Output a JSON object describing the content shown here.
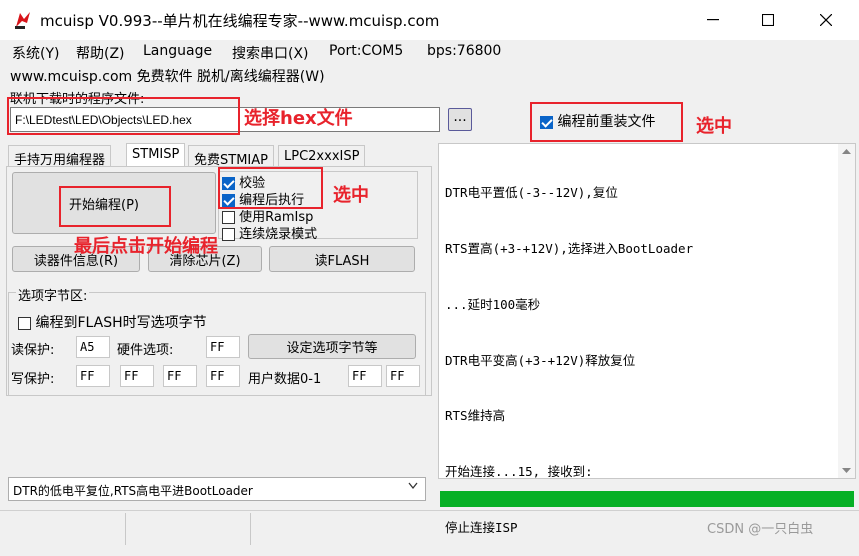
{
  "window": {
    "title": "mcuisp V0.993--单片机在线编程专家--www.mcuisp.com"
  },
  "menu": {
    "items": [
      "系统(Y)",
      "帮助(Z)",
      "Language",
      "搜索串口(X)",
      "Port:COM5",
      "bps:76800"
    ],
    "sub": "www.mcuisp.com 免费软件 脱机/离线编程器(W)"
  },
  "file": {
    "label": "联机下载时的程序文件:",
    "value": "F:\\LEDtest\\LED\\Objects\\LED.hex",
    "browse_label": "...",
    "reload_label": "编程前重装文件",
    "reload_checked": true
  },
  "tabs": [
    "手持万用编程器",
    "STMISP",
    "免费STMIAP",
    "LPC2xxxISP"
  ],
  "panel": {
    "start_button": "开始编程(P)",
    "options": [
      {
        "label": "校验",
        "checked": true
      },
      {
        "label": "编程后执行",
        "checked": true
      },
      {
        "label": "使用RamIsp",
        "checked": false
      },
      {
        "label": "连续烧录模式",
        "checked": false
      }
    ],
    "read_info_button": "读器件信息(R)",
    "clear_chip_button": "清除芯片(Z)",
    "read_flash_button": "读FLASH",
    "optbyte": {
      "title": "选项字节区:",
      "write_flash_option": "编程到FLASH时写选项字节",
      "read_protect_label": "读保护:",
      "read_protect_value": "A5",
      "hw_option_label": "硬件选项:",
      "hw_option_value": "FF",
      "set_button": "设定选项字节等",
      "write_protect_label": "写保护:",
      "write_protect_values": [
        "FF",
        "FF",
        "FF",
        "FF"
      ],
      "user_data_label": "用户数据0-1",
      "user_data_values": [
        "FF",
        "FF"
      ]
    },
    "mode_select": "DTR的低电平复位,RTS高电平进BootLoader"
  },
  "log": {
    "lines": [
      "DTR电平置低(-3--12V),复位",
      "RTS置高(+3-+12V),选择进入BootLoader",
      "...延时100毫秒",
      "DTR电平变高(+3-+12V)释放复位",
      "RTS维持高",
      "开始连接...15, 接收到:",
      "停止连接ISP"
    ]
  },
  "annotations": {
    "select_hex": "选择hex文件",
    "check1": "选中",
    "check2": "选中",
    "click_start": "最后点击开始编程"
  },
  "watermark": "CSDN @一只白虫",
  "colors": {
    "accent_check": "#0a64c8",
    "progress": "#06b025",
    "annotation": "#e8232c"
  }
}
